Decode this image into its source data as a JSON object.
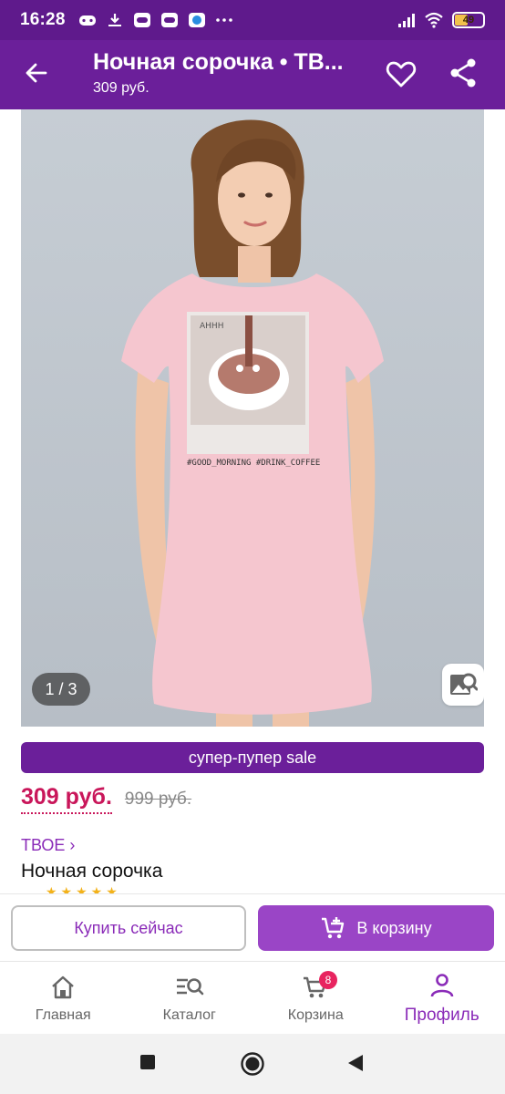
{
  "status_bar": {
    "time": "16:28",
    "battery": "49",
    "battery_level": 0.49,
    "icons": [
      "game-controller-icon",
      "download-icon",
      "app-notification-icon",
      "app-notification-icon",
      "app-notification-icon",
      "more-dots-icon",
      "signal-icon",
      "wifi-icon",
      "battery-icon"
    ]
  },
  "app_bar": {
    "title": "Ночная сорочка • ТВ...",
    "subtitle": "309 руб.",
    "color": "#6b1f9a"
  },
  "gallery": {
    "counter": "1 / 3",
    "print_text": "#GOOD_MORNING #DRINK_COFFEE",
    "print_caption": "АННН"
  },
  "sale_label": "супер-пупер sale",
  "price": {
    "current": "309 руб.",
    "old": "999 руб.",
    "current_color": "#c9165a"
  },
  "product": {
    "brand": "ТВОЕ ›",
    "name": "Ночная сорочка",
    "rating_stars": "★★★★★"
  },
  "actions": {
    "buy_now": "Купить сейчас",
    "add_to_cart": "В корзину",
    "accent": "#9a45c6"
  },
  "bottom_nav": {
    "items": [
      {
        "label": "Главная",
        "icon": "home-icon"
      },
      {
        "label": "Каталог",
        "icon": "catalog-search-icon"
      },
      {
        "label": "Корзина",
        "icon": "cart-icon",
        "badge": "8"
      },
      {
        "label": "Профиль",
        "icon": "profile-icon"
      }
    ],
    "active": "Профиль"
  }
}
